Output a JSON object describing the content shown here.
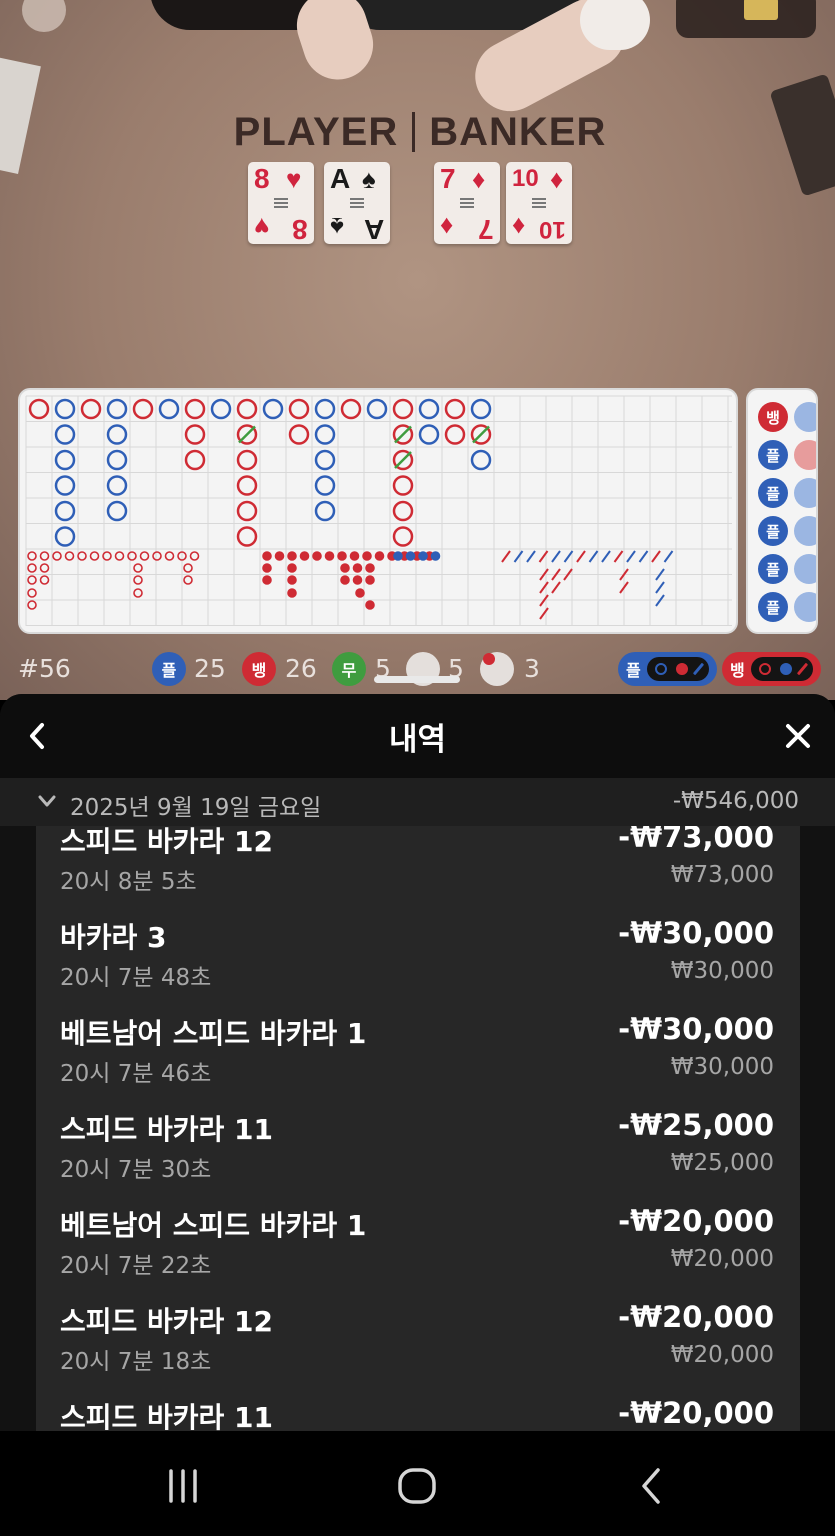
{
  "game": {
    "player_label": "PLAYER",
    "banker_label": "BANKER",
    "player_cards": [
      {
        "rank": "8",
        "suit": "♥",
        "color": "red"
      },
      {
        "rank": "A",
        "suit": "♠",
        "color": "blk"
      }
    ],
    "banker_cards": [
      {
        "rank": "7",
        "suit": "♦",
        "color": "red"
      },
      {
        "rank": "10",
        "suit": "♦",
        "color": "red"
      }
    ]
  },
  "side_road": {
    "chips": [
      "뱅",
      "플",
      "플",
      "플",
      "플",
      "플"
    ]
  },
  "stats": {
    "round": "#56",
    "player_chip": "플",
    "player_count": "25",
    "banker_chip": "뱅",
    "banker_count": "26",
    "tie_chip": "무",
    "tie_count": "5",
    "player_pair_count": "5",
    "banker_pair_count": "3",
    "predict_player": "플",
    "predict_banker": "뱅"
  },
  "colors": {
    "player_blue": "#2f5fb7",
    "banker_red": "#cf2b34",
    "tie_green": "#3f9c3f"
  },
  "history": {
    "title": "내역",
    "date_label": "2025년 9월 19일 금요일",
    "date_total": "-₩546,000",
    "items": [
      {
        "name": "스피드 바카라 12",
        "time": "20시 8분 5초",
        "amount": "-₩73,000",
        "stake": "₩73,000"
      },
      {
        "name": "바카라 3",
        "time": "20시 7분 48초",
        "amount": "-₩30,000",
        "stake": "₩30,000"
      },
      {
        "name": "베트남어 스피드 바카라 1",
        "time": "20시 7분 46초",
        "amount": "-₩30,000",
        "stake": "₩30,000"
      },
      {
        "name": "스피드 바카라 11",
        "time": "20시 7분 30초",
        "amount": "-₩25,000",
        "stake": "₩25,000"
      },
      {
        "name": "베트남어 스피드 바카라 1",
        "time": "20시 7분 22초",
        "amount": "-₩20,000",
        "stake": "₩20,000"
      },
      {
        "name": "스피드 바카라 12",
        "time": "20시 7분 18초",
        "amount": "-₩20,000",
        "stake": "₩20,000"
      },
      {
        "name": "스피드 바카라 11",
        "time": "",
        "amount": "-₩20,000",
        "stake": ""
      }
    ]
  }
}
